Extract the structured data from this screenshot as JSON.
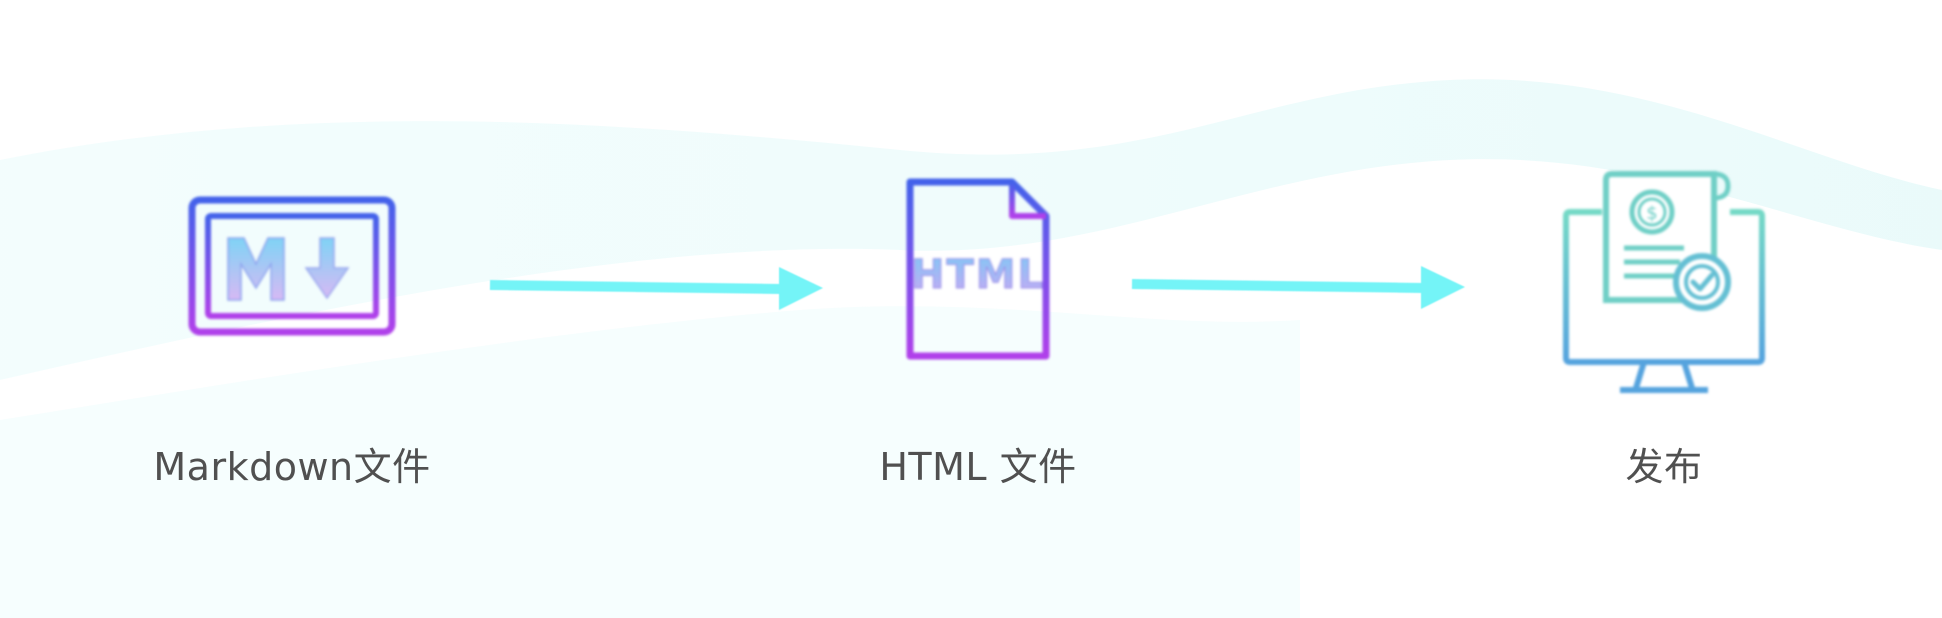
{
  "colors": {
    "arrow": "#74F4F7",
    "label_text": "#505050",
    "icon_gradient_top": "#4362EA",
    "icon_gradient_bottom": "#B040EA",
    "icon_teal": "#6ED7C9",
    "icon_blue": "#55A9DE",
    "wave": "#ECFBFB"
  },
  "steps": [
    {
      "label": "Markdown文件",
      "icon": "markdown-icon"
    },
    {
      "label": "HTML 文件",
      "icon": "html-file-icon"
    },
    {
      "label": "发布",
      "icon": "publish-monitor-icon"
    }
  ],
  "html_icon_text": "HTML"
}
